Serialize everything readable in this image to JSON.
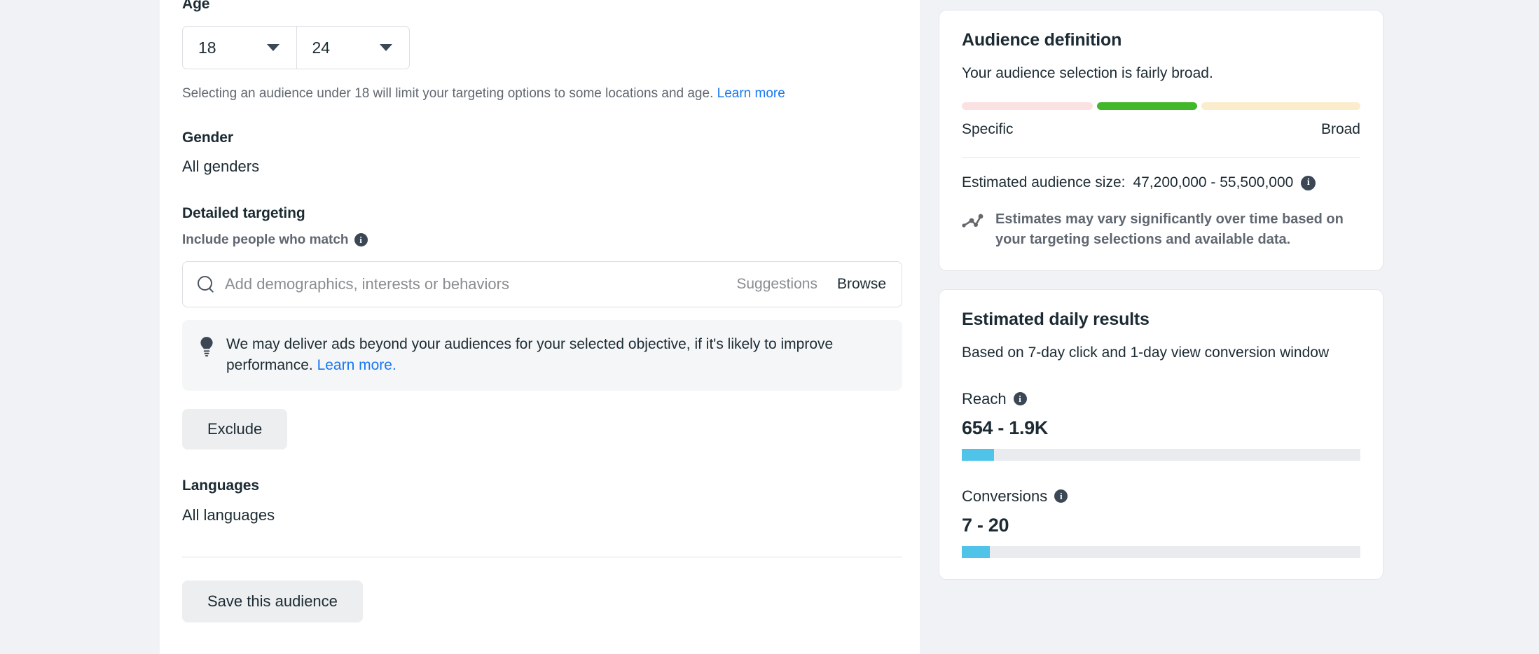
{
  "main": {
    "age": {
      "label": "Age",
      "min_value": "18",
      "max_value": "24",
      "helper_text": "Selecting an audience under 18 will limit your targeting options to some locations and age.",
      "helper_link": "Learn more"
    },
    "gender": {
      "label": "Gender",
      "value": "All genders"
    },
    "detailed_targeting": {
      "label": "Detailed targeting",
      "sublabel": "Include people who match",
      "search_placeholder": "Add demographics, interests or behaviors",
      "search_value": "",
      "suggestions_label": "Suggestions",
      "browse_label": "Browse",
      "notice_text": "We may deliver ads beyond your audiences for your selected objective, if it's likely to improve performance.",
      "notice_link": "Learn more.",
      "exclude_label": "Exclude"
    },
    "languages": {
      "label": "Languages",
      "value": "All languages"
    },
    "save_audience_label": "Save this audience"
  },
  "sidebar": {
    "audience_definition": {
      "title": "Audience definition",
      "description": "Your audience selection is fairly broad.",
      "scale_left_label": "Specific",
      "scale_right_label": "Broad",
      "meter_colors": {
        "specific": "#fbe2e2",
        "active": "#42b72a",
        "broad": "#fbeccb"
      },
      "estimated_size_label": "Estimated audience size:",
      "estimated_size_value": "47,200,000 - 55,500,000",
      "estimates_note": "Estimates may vary significantly over time based on your targeting selections and available data."
    },
    "daily_results": {
      "title": "Estimated daily results",
      "subtitle": "Based on 7-day click and 1-day view conversion window",
      "metrics": [
        {
          "label": "Reach",
          "value": "654 - 1.9K",
          "bar_percent": 8,
          "bar_color": "#4fc3e8"
        },
        {
          "label": "Conversions",
          "value": "7 - 20",
          "bar_percent": 7,
          "bar_color": "#4fc3e8"
        }
      ]
    }
  },
  "icons": {
    "search": "search-icon",
    "info": "info-icon",
    "bulb": "lightbulb-icon",
    "trend": "trend-line-icon",
    "caret": "chevron-down-icon"
  }
}
